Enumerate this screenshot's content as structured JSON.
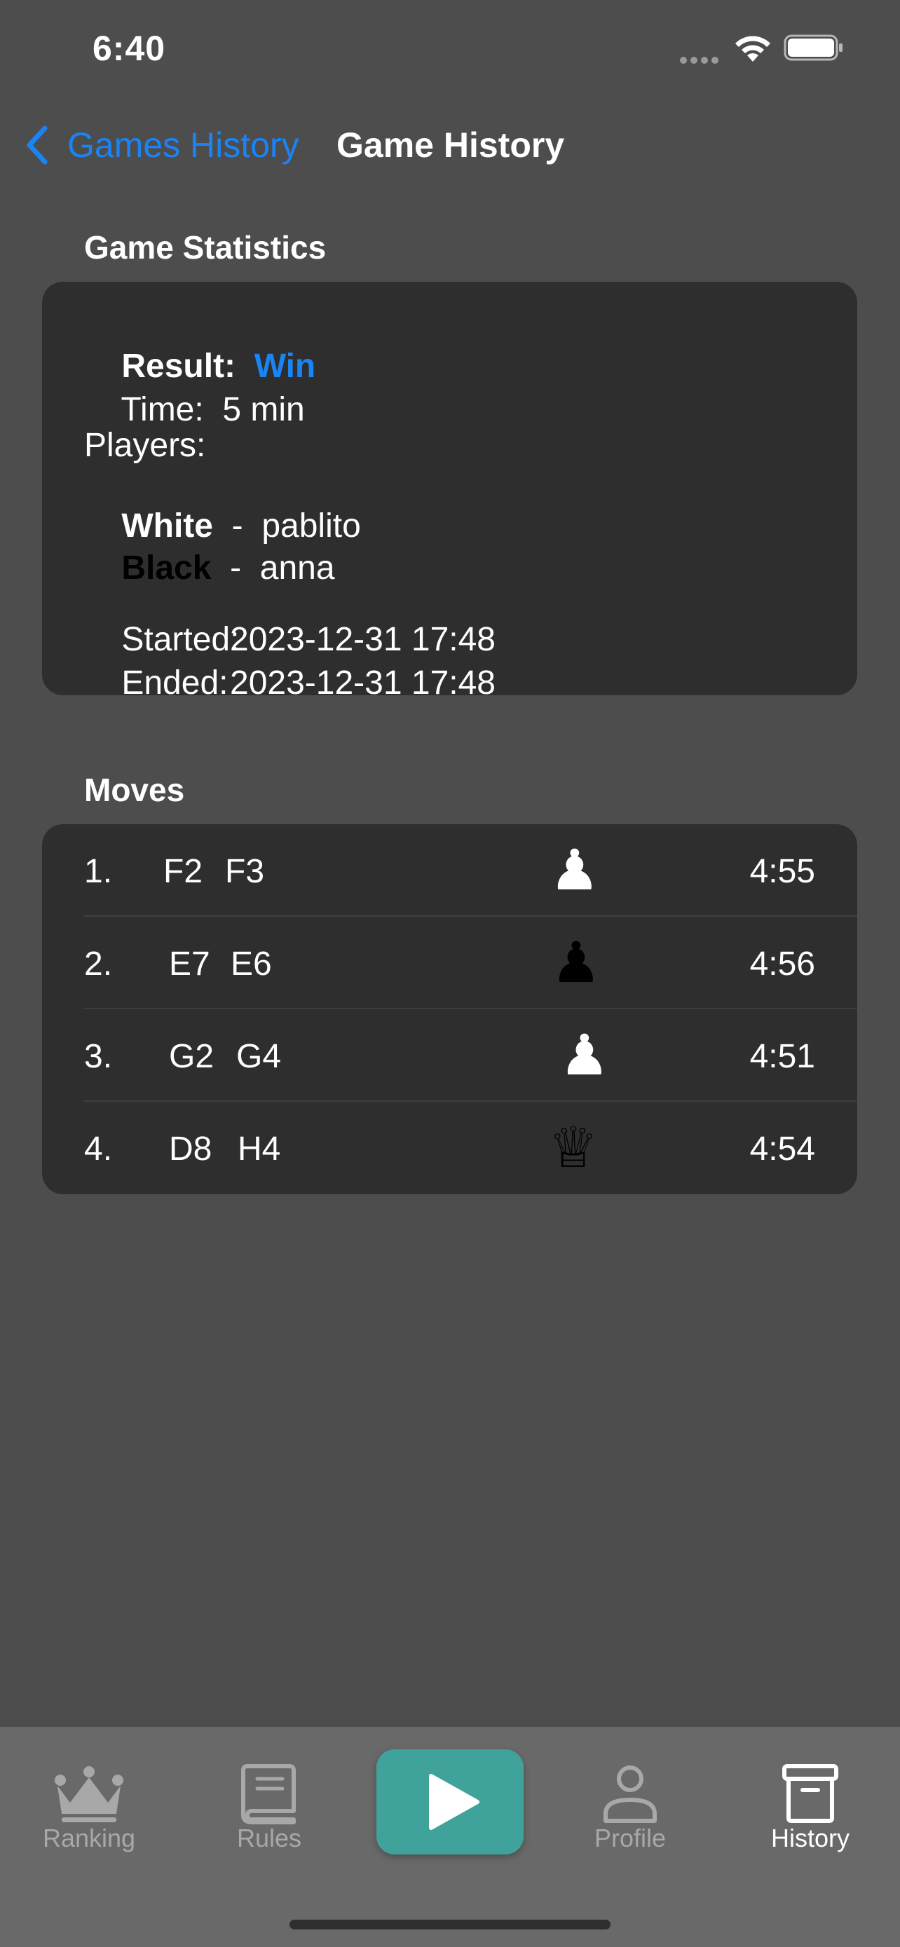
{
  "status_bar": {
    "time": "6:40"
  },
  "nav": {
    "back_label": "Games History",
    "title": "Game History"
  },
  "stats": {
    "heading": "Game Statistics",
    "result_label": "Result:",
    "result_value": "Win",
    "time_label": "Time:",
    "time_value": "5 min",
    "players_label": "Players:",
    "white_label": "White",
    "white_player": "pablito",
    "black_label": "Black",
    "black_player": "anna",
    "separator": "-",
    "started_label": "Started:",
    "started_value": "2023-12-31 17:48",
    "ended_label": "Ended:",
    "ended_value": "2023-12-31 17:48"
  },
  "moves": {
    "heading": "Moves",
    "rows": [
      {
        "num": "1.",
        "from": "F2",
        "to": "F3",
        "piece_icon": "white-pawn",
        "piece_glyph": "♟",
        "piece_color": "#ffffff",
        "time": "4:55"
      },
      {
        "num": "2.",
        "from": "E7",
        "to": "E6",
        "piece_icon": "black-pawn",
        "piece_glyph": "♟",
        "piece_color": "#000000",
        "time": "4:56"
      },
      {
        "num": "3.",
        "from": "G2",
        "to": "G4",
        "piece_icon": "white-pawn",
        "piece_glyph": "♟",
        "piece_color": "#ffffff",
        "time": "4:51"
      },
      {
        "num": "4.",
        "from": "D8",
        "to": "H4",
        "piece_icon": "black-queen",
        "piece_glyph": "♕",
        "piece_color": "#000000",
        "time": "4:54"
      }
    ]
  },
  "tabs": {
    "ranking": "Ranking",
    "rules": "Rules",
    "profile": "Profile",
    "history": "History",
    "active": "history"
  },
  "colors": {
    "accent": "#1a84f5",
    "play_button": "#40a39b",
    "background": "#4d4d4d",
    "card": "#2e2e2e",
    "tab_bar": "#696969"
  }
}
